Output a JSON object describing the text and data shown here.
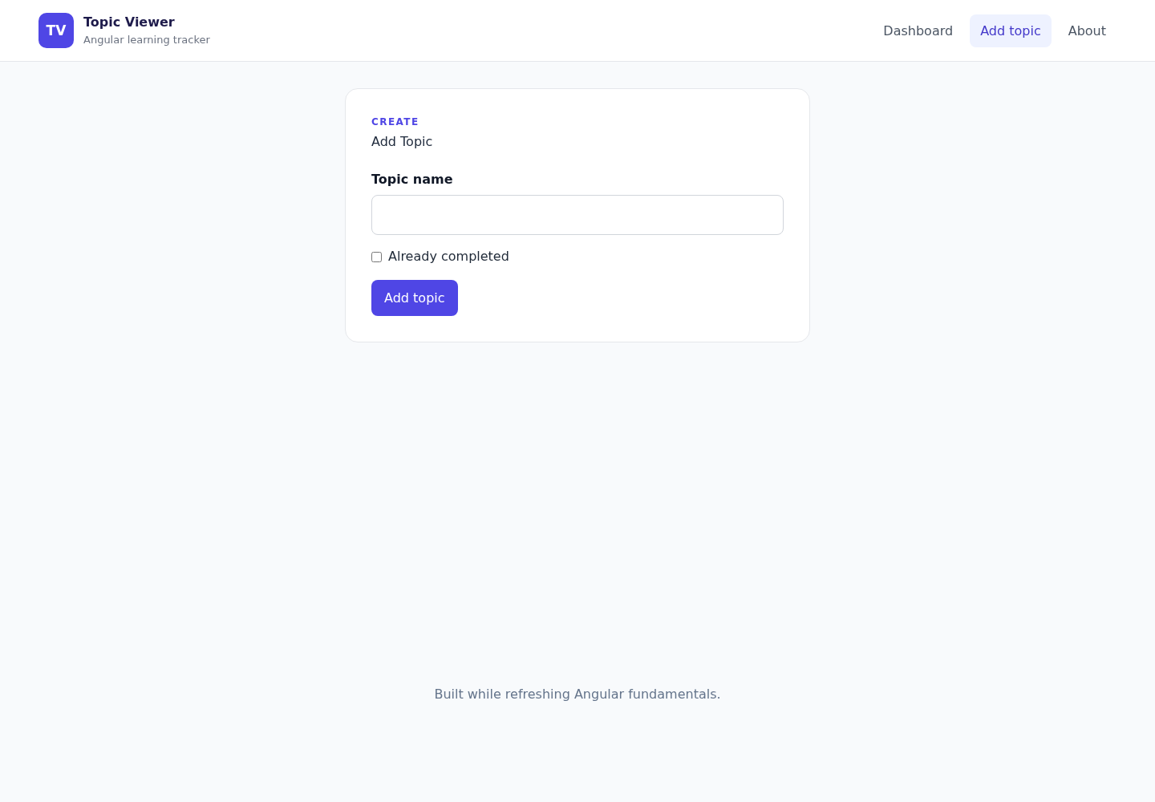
{
  "header": {
    "logo": "TV",
    "title": "Topic Viewer",
    "subtitle": "Angular learning tracker"
  },
  "nav": [
    {
      "label": "Dashboard",
      "selected": false
    },
    {
      "label": "Add topic",
      "selected": true
    },
    {
      "label": "About",
      "selected": false
    }
  ],
  "form": {
    "eyebrow": "CREATE",
    "title": "Add Topic",
    "field": {
      "label": "Topic name"
    },
    "checkbox": {
      "label": "Already completed",
      "checked": false
    },
    "submit": "Add topic"
  },
  "footer": "Built while refreshing Angular fundamentals."
}
